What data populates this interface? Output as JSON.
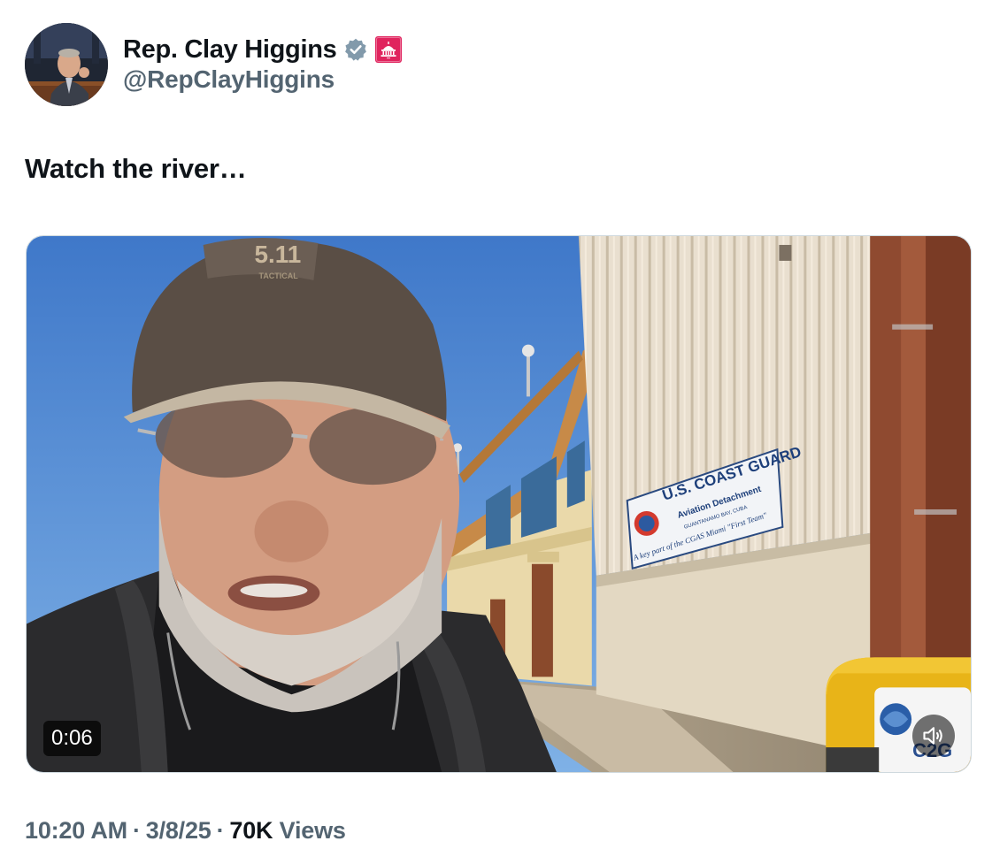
{
  "author": {
    "display_name": "Rep. Clay Higgins",
    "handle": "@RepClayHiggins",
    "verified_icon": "verified-badge-icon",
    "affiliation_icon": "us-capitol-badge-icon",
    "verified_color": "#829aab",
    "affiliation_color": "#e0245e"
  },
  "tweet": {
    "text": "Watch the river…"
  },
  "media": {
    "type": "video",
    "duration": "0:06",
    "sign": {
      "line1": "U.S. COAST GUARD",
      "line2": "Aviation Detachment",
      "line3": "GUANTANAMO BAY, CUBA",
      "line4": "A key part of the CGAS Miami \"First Team\""
    },
    "cap_text": "5.11",
    "cap_subtext": "TACTICAL",
    "case_logo_text": "C2G",
    "mute_icon": "speaker-muted-icon"
  },
  "footer": {
    "time": "10:20 AM",
    "date": "3/8/25",
    "views_count": "70K",
    "views_label": "Views",
    "separator": "·"
  }
}
